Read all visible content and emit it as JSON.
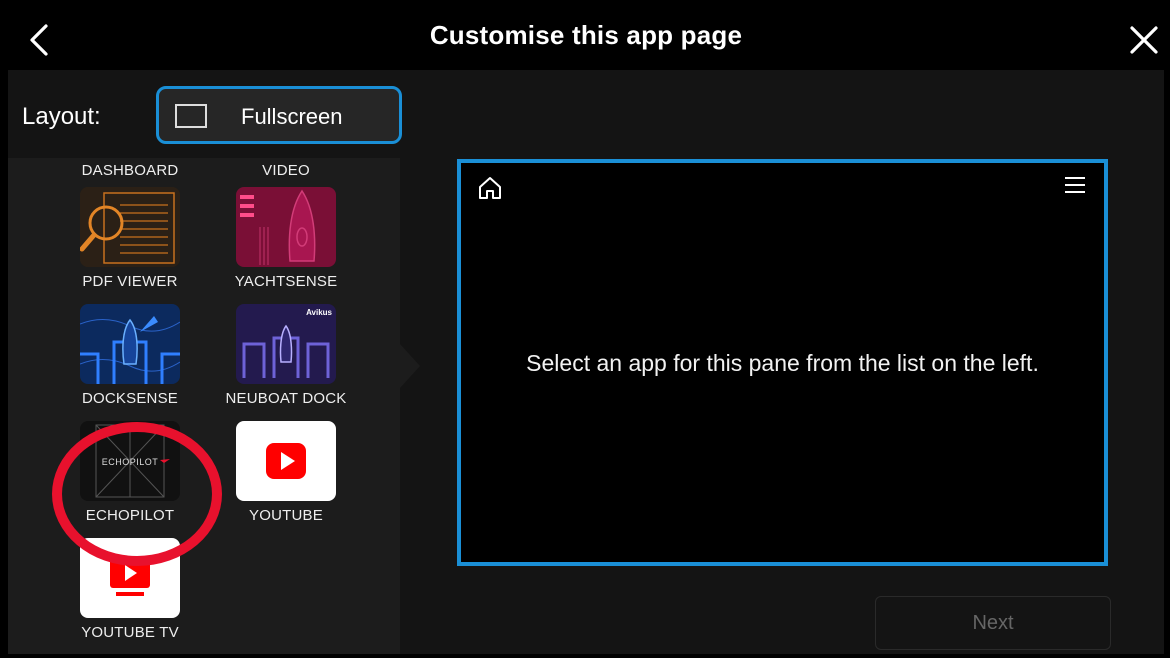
{
  "header": {
    "title": "Customise this app page",
    "back_icon": "chevron-left-icon",
    "close_icon": "close-icon"
  },
  "layout": {
    "label": "Layout:",
    "option_label": "Fullscreen",
    "option_icon": "fullscreen-rect-icon"
  },
  "apps": [
    {
      "name": "DASHBOARD",
      "icon": "dashboard-icon"
    },
    {
      "name": "VIDEO",
      "icon": "video-icon"
    },
    {
      "name": "PDF VIEWER",
      "icon": "pdf-viewer-icon"
    },
    {
      "name": "YACHTSENSE",
      "icon": "yachtsense-icon"
    },
    {
      "name": "DOCKSENSE",
      "icon": "docksense-icon"
    },
    {
      "name": "NEUBOAT DOCK",
      "icon": "neuboat-dock-icon",
      "badge": "Avikus"
    },
    {
      "name": "ECHOPILOT",
      "icon": "echopilot-icon",
      "logo_text": "ECHOPILOT"
    },
    {
      "name": "YOUTUBE",
      "icon": "youtube-icon"
    },
    {
      "name": "YOUTUBE TV",
      "icon": "youtube-tv-icon"
    }
  ],
  "pane": {
    "message": "Select an app for this pane from the list on the left.",
    "home_icon": "home-icon",
    "menu_icon": "hamburger-menu-icon"
  },
  "next_button": {
    "label": "Next",
    "state": "disabled"
  },
  "colors": {
    "accent": "#1a8fd6",
    "highlight": "#e8112d",
    "youtube_red": "#ff0000"
  }
}
